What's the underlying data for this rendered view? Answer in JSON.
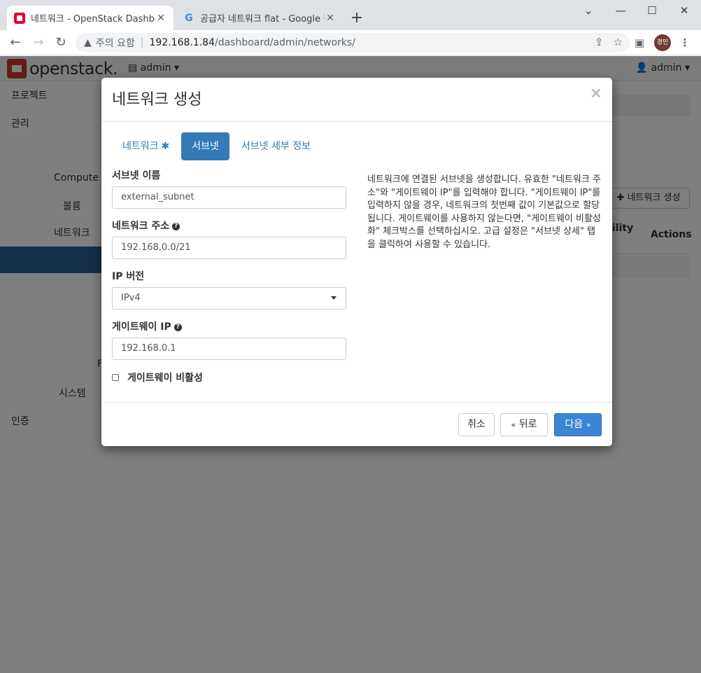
{
  "browser": {
    "tabs": [
      {
        "title": "네트워크 - OpenStack Dashboard",
        "active": true
      },
      {
        "title": "공급자 네트워크 flat - Google 검색",
        "active": false
      }
    ],
    "address": {
      "security_label": "주의 요함",
      "host": "192.168.1.84",
      "path": "/dashboard/admin/networks/"
    },
    "profile_initials": "경민"
  },
  "openstack": {
    "logo_text": "openstack.",
    "project_menu": "admin",
    "user_menu": "admin",
    "sidebar": {
      "project": "프로젝트",
      "admin": "관리",
      "compute": "Compute",
      "volume": "볼륨",
      "network": "네트워크",
      "system": "시스템",
      "identity": "인증",
      "partial_letter": "F"
    },
    "create_network_button": "네트워크 생성",
    "col_availability": "ility",
    "col_actions": "Actions"
  },
  "modal": {
    "title": "네트워크 생성",
    "tabs": [
      {
        "label": "네트워크",
        "required": "✱"
      },
      {
        "label": "서브넷"
      },
      {
        "label": "서브넷 세부 정보"
      }
    ],
    "fields": {
      "subnet_name": {
        "label": "서브넷 이름",
        "value": "external_subnet"
      },
      "network_address": {
        "label": "네트워크 주소",
        "value": "192.168.0.0/21"
      },
      "ip_version": {
        "label": "IP 버전",
        "value": "IPv4"
      },
      "gateway_ip": {
        "label": "게이트웨이 IP",
        "value": "192.168.0.1"
      },
      "disable_gateway": {
        "label": "게이트웨이 비활성",
        "checked": false
      }
    },
    "help_text": "네트워크에 연결된 서브넷을 생성합니다. 유효한 \"네트워크 주소\"와 \"게이트웨이 IP\"를 입력해야 합니다. \"게이트웨이 IP\"를 입력하지 않을 경우, 네트워크의 첫번째 값이 기본값으로 할당됩니다. 게이트웨이를 사용하지 않는다면, \"게이트웨이 비활성화\" 체크박스를 선택하십시오. 고급 설정은 \"서브넷 상세\" 탭을 클릭하여 사용할 수 있습니다.",
    "buttons": {
      "cancel": "취소",
      "back": "뒤로",
      "next": "다음"
    }
  },
  "colors": {
    "primary": "#337ab7",
    "openstack_red": "#c0392b",
    "sidebar_active": "#286090"
  }
}
